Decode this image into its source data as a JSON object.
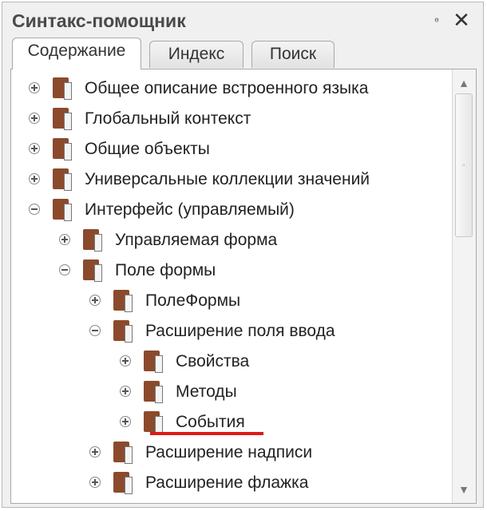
{
  "window": {
    "title": "Синтакс-помощник",
    "pin_glyph": "ᶱ",
    "close_glyph": "✕"
  },
  "tabs": [
    {
      "label": "Содержание",
      "active": true
    },
    {
      "label": "Индекс",
      "active": false
    },
    {
      "label": "Поиск",
      "active": false
    }
  ],
  "tree": [
    {
      "label": "Общее описание встроенного языка",
      "level": 0,
      "state": "collapsed"
    },
    {
      "label": "Глобальный контекст",
      "level": 0,
      "state": "collapsed"
    },
    {
      "label": "Общие объекты",
      "level": 0,
      "state": "collapsed"
    },
    {
      "label": "Универсальные коллекции значений",
      "level": 0,
      "state": "collapsed"
    },
    {
      "label": "Интерфейс (управляемый)",
      "level": 0,
      "state": "expanded"
    },
    {
      "label": "Управляемая форма",
      "level": 1,
      "state": "collapsed"
    },
    {
      "label": "Поле формы",
      "level": 1,
      "state": "expanded"
    },
    {
      "label": "ПолеФормы",
      "level": 2,
      "state": "collapsed"
    },
    {
      "label": "Расширение поля ввода",
      "level": 2,
      "state": "expanded"
    },
    {
      "label": "Свойства",
      "level": 3,
      "state": "collapsed"
    },
    {
      "label": "Методы",
      "level": 3,
      "state": "collapsed"
    },
    {
      "label": "События",
      "level": 3,
      "state": "collapsed",
      "highlighted": true
    },
    {
      "label": "Расширение надписи",
      "level": 2,
      "state": "collapsed"
    },
    {
      "label": "Расширение флажка",
      "level": 2,
      "state": "collapsed"
    }
  ],
  "highlight_color": "#e01818",
  "book_color": "#8b4a2c",
  "scrollbar": {
    "up_glyph": "▲",
    "down_glyph": "▼",
    "grip_glyph": "▫"
  }
}
